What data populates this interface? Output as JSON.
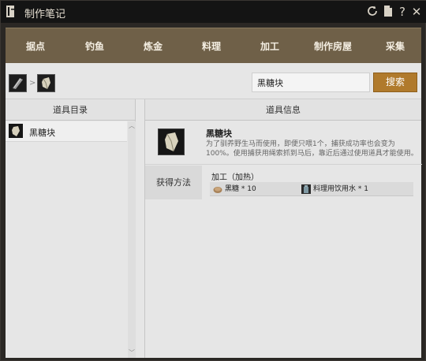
{
  "window": {
    "title": "制作笔记"
  },
  "titlebar_icons": [
    "refresh-icon",
    "document-icon",
    "help-icon",
    "close-icon"
  ],
  "titlebar_labels": {
    "help": "?",
    "close": "✕"
  },
  "nav": {
    "items": [
      "据点",
      "钓鱼",
      "炼金",
      "料理",
      "加工",
      "制作房屋",
      "采集"
    ]
  },
  "breadcrumb": {
    "separator": ">"
  },
  "search": {
    "value": "黑糖块",
    "placeholder": "",
    "button_label": "搜索"
  },
  "left_panel": {
    "header": "道具目录",
    "items": [
      {
        "label": "黑糖块"
      }
    ]
  },
  "right_panel": {
    "header": "道具信息",
    "item_name": "黑糖块",
    "item_desc": "为了驯养野生马而使用，即便只喂1个，捕获成功率也会变为100%。使用捕获用绳索抓到马后，靠近后通过使用道具才能使用。",
    "method_label": "获得方法",
    "method_title": "加工（加热）",
    "ingredients": [
      {
        "text": "黑糖 * 10"
      },
      {
        "text": "料理用饮用水 * 1"
      }
    ]
  },
  "colors": {
    "nav_background": "#6f6048",
    "search_button": "#b07a2c",
    "title_bar": "#141414",
    "panel": "#e6e6e6"
  }
}
